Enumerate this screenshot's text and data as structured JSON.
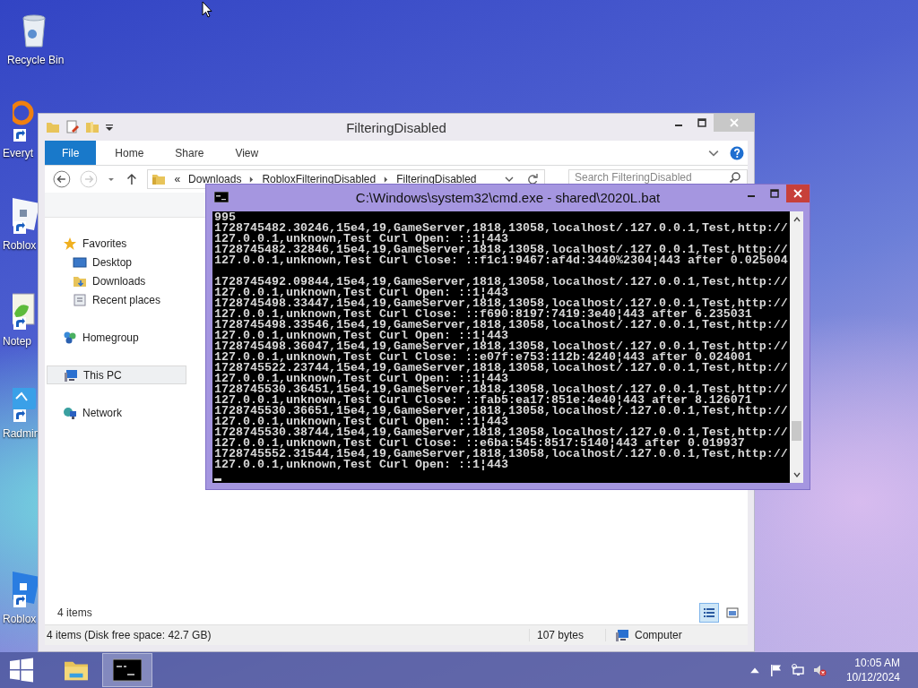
{
  "desktop_icons": [
    {
      "label": "Recycle Bin",
      "kind": "recycle",
      "shortcut": false
    },
    {
      "label": "Everyt",
      "kind": "search",
      "shortcut": true
    },
    {
      "label": "Roblox",
      "kind": "roblox",
      "shortcut": true
    },
    {
      "label": "Notep",
      "kind": "notepad",
      "shortcut": true
    },
    {
      "label": "Radmin",
      "kind": "radmin",
      "shortcut": true
    },
    {
      "label": "Roblox",
      "kind": "studio",
      "shortcut": true
    }
  ],
  "explorer": {
    "title": "FilteringDisabled",
    "tabs": [
      {
        "label": "File",
        "selected": true
      },
      {
        "label": "Home",
        "selected": false
      },
      {
        "label": "Share",
        "selected": false
      },
      {
        "label": "View",
        "selected": false
      }
    ],
    "address": {
      "overflow": "«",
      "segments": [
        "Downloads",
        "RobloxFilteringDisabled",
        "FilteringDisabled"
      ]
    },
    "search": {
      "placeholder": "Search FilteringDisabled"
    },
    "nav": [
      {
        "label": "Favorites",
        "kind": "star",
        "selected": false,
        "children": [
          {
            "label": "Desktop",
            "kind": "desktop",
            "selected": false
          },
          {
            "label": "Downloads",
            "kind": "downloads",
            "selected": false
          },
          {
            "label": "Recent places",
            "kind": "recent",
            "selected": false
          }
        ]
      },
      {
        "label": "Homegroup",
        "kind": "homegroup",
        "selected": false
      },
      {
        "label": "This PC",
        "kind": "pc",
        "selected": true
      },
      {
        "label": "Network",
        "kind": "network",
        "selected": false
      }
    ],
    "item_count": "4 items",
    "views": [
      {
        "kind": "details",
        "selected": true
      },
      {
        "kind": "tiles",
        "selected": false
      }
    ],
    "status": {
      "items": "4 items (Disk free space: 42.7 GB)",
      "size": "107 bytes",
      "zone": "Computer"
    }
  },
  "console": {
    "title": "C:\\Windows\\system32\\cmd.exe - shared\\2020L.bat",
    "lines": [
      {
        "kind": "text",
        "text": "995"
      },
      {
        "kind": "text",
        "text": "1728745482.30246,15e4,19,GameServer,1818,13058,localhost/.127.0.0.1,Test,http://"
      },
      {
        "kind": "text",
        "text": "127.0.0.1,unknown,Test Curl Open: ::1¦443"
      },
      {
        "kind": "text",
        "text": "1728745482.32846,15e4,19,GameServer,1818,13058,localhost/.127.0.0.1,Test,http://"
      },
      {
        "kind": "text",
        "text": "127.0.0.1,unknown,Test Curl Close: ::f1c1:9467:af4d:3440%2304¦443 after 0.025004"
      },
      {
        "kind": "blank"
      },
      {
        "kind": "text",
        "text": "1728745492.09844,15e4,19,GameServer,1818,13058,localhost/.127.0.0.1,Test,http://"
      },
      {
        "kind": "text",
        "text": "127.0.0.1,unknown,Test Curl Open: ::1¦443"
      },
      {
        "kind": "text",
        "text": "1728745498.33447,15e4,19,GameServer,1818,13058,localhost/.127.0.0.1,Test,http://"
      },
      {
        "kind": "text",
        "text": "127.0.0.1,unknown,Test Curl Close: ::f690:8197:7419:3e40¦443 after 6.235031"
      },
      {
        "kind": "text",
        "text": "1728745498.33546,15e4,19,GameServer,1818,13058,localhost/.127.0.0.1,Test,http://"
      },
      {
        "kind": "text",
        "text": "127.0.0.1,unknown,Test Curl Open: ::1¦443"
      },
      {
        "kind": "text",
        "text": "1728745498.36047,15e4,19,GameServer,1818,13058,localhost/.127.0.0.1,Test,http://"
      },
      {
        "kind": "text",
        "text": "127.0.0.1,unknown,Test Curl Close: ::e07f:e753:112b:4240¦443 after 0.024001"
      },
      {
        "kind": "text",
        "text": "1728745522.23744,15e4,19,GameServer,1818,13058,localhost/.127.0.0.1,Test,http://"
      },
      {
        "kind": "text",
        "text": "127.0.0.1,unknown,Test Curl Open: ::1¦443"
      },
      {
        "kind": "text",
        "text": "1728745530.36451,15e4,19,GameServer,1818,13058,localhost/.127.0.0.1,Test,http://"
      },
      {
        "kind": "text",
        "text": "127.0.0.1,unknown,Test Curl Close: ::fab5:ea17:851e:4e40¦443 after 8.126071"
      },
      {
        "kind": "text",
        "text": "1728745530.36651,15e4,19,GameServer,1818,13058,localhost/.127.0.0.1,Test,http://"
      },
      {
        "kind": "text",
        "text": "127.0.0.1,unknown,Test Curl Open: ::1¦443"
      },
      {
        "kind": "text",
        "text": "1728745530.38744,15e4,19,GameServer,1818,13058,localhost/.127.0.0.1,Test,http://"
      },
      {
        "kind": "text",
        "text": "127.0.0.1,unknown,Test Curl Close: ::e6ba:545:8517:5140¦443 after 0.019937"
      },
      {
        "kind": "text",
        "text": "1728745552.31544,15e4,19,GameServer,1818,13058,localhost/.127.0.0.1,Test,http://"
      },
      {
        "kind": "text",
        "text": "127.0.0.1,unknown,Test Curl Open: ::1¦443"
      }
    ]
  },
  "taskbar": {
    "apps": [
      {
        "kind": "explorer",
        "selected": false
      },
      {
        "kind": "console",
        "selected": true
      }
    ],
    "tray": {
      "volume_muted": true,
      "time": "10:05 AM",
      "date": "10/12/2024"
    }
  }
}
